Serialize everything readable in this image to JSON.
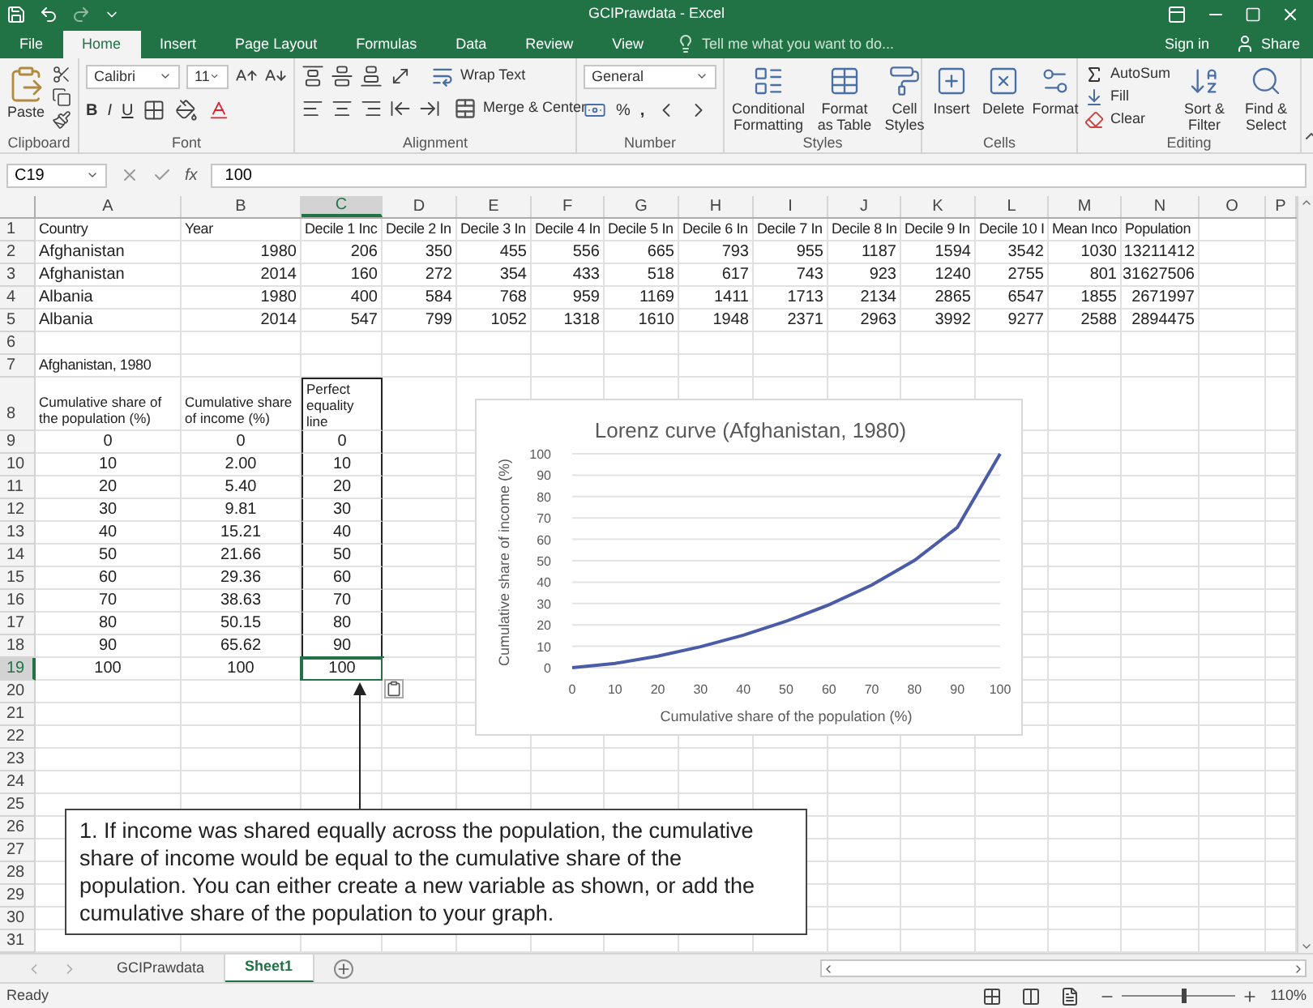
{
  "window": {
    "title": "GCIPrawdata - Excel"
  },
  "menu_tabs": [
    {
      "label": "File",
      "selected": false
    },
    {
      "label": "Home",
      "selected": true
    },
    {
      "label": "Insert",
      "selected": false
    },
    {
      "label": "Page Layout",
      "selected": false
    },
    {
      "label": "Formulas",
      "selected": false
    },
    {
      "label": "Data",
      "selected": false
    },
    {
      "label": "Review",
      "selected": false
    },
    {
      "label": "View",
      "selected": false
    }
  ],
  "tell_me": {
    "placeholder": "Tell me what you want to do..."
  },
  "sign_in": "Sign in",
  "share": "Share",
  "ribbon": {
    "clipboard": {
      "paste": "Paste",
      "label": "Clipboard"
    },
    "font": {
      "name": "Calibri",
      "size": "11",
      "bold": "B",
      "italic": "I",
      "underline": "U",
      "label": "Font"
    },
    "alignment": {
      "wrap": "Wrap Text",
      "merge": "Merge & Center",
      "label": "Alignment"
    },
    "number": {
      "format": "General",
      "percent": "%",
      "comma": ",",
      "label": "Number"
    },
    "styles": {
      "buttons": [
        "Conditional Formatting",
        "Format as Table",
        "Cell Styles"
      ],
      "label": "Styles"
    },
    "cells": {
      "buttons": [
        "Insert",
        "Delete",
        "Format"
      ],
      "label": "Cells"
    },
    "editing": {
      "autosum": "AutoSum",
      "fill": "Fill",
      "clear": "Clear",
      "buttons": [
        "Sort & Filter",
        "Find & Select"
      ],
      "label": "Editing"
    }
  },
  "formula_bar": {
    "name_box": "C19",
    "fx": "fx",
    "value": "100"
  },
  "columns": [
    {
      "label": "A",
      "selected": false
    },
    {
      "label": "B",
      "selected": false
    },
    {
      "label": "C",
      "selected": true
    },
    {
      "label": "D",
      "selected": false
    },
    {
      "label": "E",
      "selected": false
    },
    {
      "label": "F",
      "selected": false
    },
    {
      "label": "G",
      "selected": false
    },
    {
      "label": "H",
      "selected": false
    },
    {
      "label": "I",
      "selected": false
    },
    {
      "label": "J",
      "selected": false
    },
    {
      "label": "K",
      "selected": false
    },
    {
      "label": "L",
      "selected": false
    },
    {
      "label": "M",
      "selected": false
    },
    {
      "label": "N",
      "selected": false
    },
    {
      "label": "O",
      "selected": false
    },
    {
      "label": "P",
      "selected": false
    }
  ],
  "rows": [
    {
      "number": "1",
      "kind": "header",
      "selected": false,
      "cells": [
        "Country",
        "Year",
        "Decile 1 Inc",
        "Decile 2 In",
        "Decile 3 In",
        "Decile 4 In",
        "Decile 5 In",
        "Decile 6 In",
        "Decile 7 In",
        "Decile 8 In",
        "Decile 9 In",
        "Decile 10 I",
        "Mean Inco",
        "Population"
      ]
    },
    {
      "number": "2",
      "kind": "data",
      "selected": false,
      "cells": [
        "Afghanistan",
        "1980",
        "206",
        "350",
        "455",
        "556",
        "665",
        "793",
        "955",
        "1187",
        "1594",
        "3542",
        "1030",
        "13211412"
      ]
    },
    {
      "number": "3",
      "kind": "data",
      "selected": false,
      "cells": [
        "Afghanistan",
        "2014",
        "160",
        "272",
        "354",
        "433",
        "518",
        "617",
        "743",
        "923",
        "1240",
        "2755",
        "801",
        "31627506"
      ]
    },
    {
      "number": "4",
      "kind": "data",
      "selected": false,
      "cells": [
        "Albania",
        "1980",
        "400",
        "584",
        "768",
        "959",
        "1169",
        "1411",
        "1713",
        "2134",
        "2865",
        "6547",
        "1855",
        "2671997"
      ]
    },
    {
      "number": "5",
      "kind": "data",
      "selected": false,
      "cells": [
        "Albania",
        "2014",
        "547",
        "799",
        "1052",
        "1318",
        "1610",
        "1948",
        "2371",
        "2963",
        "3992",
        "9277",
        "2588",
        "2894475"
      ]
    },
    {
      "number": "6",
      "kind": "data",
      "selected": false,
      "cells": []
    },
    {
      "number": "7",
      "kind": "header",
      "selected": false,
      "cells": [
        "Afghanistan, 1980"
      ]
    },
    {
      "number": "8",
      "kind": "wrapped",
      "selected": false,
      "boxed": true,
      "cells": [
        "Cumulative share of the population (%)",
        "Cumulative share of income (%)",
        "Perfect equality line"
      ]
    },
    {
      "number": "9",
      "kind": "centered",
      "selected": false,
      "boxed": true,
      "cells": [
        "0",
        "0",
        "0"
      ]
    },
    {
      "number": "10",
      "kind": "centered",
      "selected": false,
      "boxed": true,
      "cells": [
        "10",
        "2.00",
        "10"
      ]
    },
    {
      "number": "11",
      "kind": "centered",
      "selected": false,
      "boxed": true,
      "cells": [
        "20",
        "5.40",
        "20"
      ]
    },
    {
      "number": "12",
      "kind": "centered",
      "selected": false,
      "boxed": true,
      "cells": [
        "30",
        "9.81",
        "30"
      ]
    },
    {
      "number": "13",
      "kind": "centered",
      "selected": false,
      "boxed": true,
      "cells": [
        "40",
        "15.21",
        "40"
      ]
    },
    {
      "number": "14",
      "kind": "centered",
      "selected": false,
      "boxed": true,
      "cells": [
        "50",
        "21.66",
        "50"
      ]
    },
    {
      "number": "15",
      "kind": "centered",
      "selected": false,
      "boxed": true,
      "cells": [
        "60",
        "29.36",
        "60"
      ]
    },
    {
      "number": "16",
      "kind": "centered",
      "selected": false,
      "boxed": true,
      "cells": [
        "70",
        "38.63",
        "70"
      ]
    },
    {
      "number": "17",
      "kind": "centered",
      "selected": false,
      "boxed": true,
      "cells": [
        "80",
        "50.15",
        "80"
      ]
    },
    {
      "number": "18",
      "kind": "centered",
      "selected": false,
      "boxed": true,
      "cells": [
        "90",
        "65.62",
        "90"
      ]
    },
    {
      "number": "19",
      "kind": "centered",
      "selected": true,
      "boxed": true,
      "cells": [
        "100",
        "100",
        "100"
      ]
    },
    {
      "number": "20",
      "kind": "data",
      "selected": false,
      "cells": []
    },
    {
      "number": "21",
      "kind": "data",
      "selected": false,
      "cells": []
    },
    {
      "number": "22",
      "kind": "data",
      "selected": false,
      "cells": []
    },
    {
      "number": "23",
      "kind": "data",
      "selected": false,
      "cells": []
    },
    {
      "number": "24",
      "kind": "data",
      "selected": false,
      "cells": []
    },
    {
      "number": "25",
      "kind": "data",
      "selected": false,
      "cells": []
    },
    {
      "number": "26",
      "kind": "data",
      "selected": false,
      "cells": []
    },
    {
      "number": "27",
      "kind": "data",
      "selected": false,
      "cells": []
    },
    {
      "number": "28",
      "kind": "data",
      "selected": false,
      "cells": []
    },
    {
      "number": "29",
      "kind": "data",
      "selected": false,
      "cells": []
    },
    {
      "number": "30",
      "kind": "data",
      "selected": false,
      "cells": []
    },
    {
      "number": "31",
      "kind": "data",
      "selected": false,
      "cells": []
    }
  ],
  "chart": {
    "chart_data": {
      "type": "line",
      "title": "Lorenz curve (Afghanistan, 1980)",
      "xlabel": "Cumulative share of the population (%)",
      "ylabel": "Cumulative share of income (%)",
      "x": [
        0,
        10,
        20,
        30,
        40,
        50,
        60,
        70,
        80,
        90,
        100
      ],
      "series": [
        {
          "color": "#4a5ca8",
          "values": [
            0,
            2,
            5.4,
            9.8,
            15.2,
            21.7,
            29.4,
            38.6,
            50.2,
            65.6,
            100
          ]
        }
      ],
      "xticks": [
        0,
        10,
        20,
        30,
        40,
        50,
        60,
        70,
        80,
        90,
        100
      ],
      "xlim": [
        0,
        100
      ],
      "grid": true,
      "yticks": [
        0,
        10,
        20,
        30,
        40,
        50,
        60,
        70,
        80,
        90,
        100
      ],
      "ylim": [
        0,
        100
      ]
    }
  },
  "callout": "1. If income was shared equally across the population, the cumulative share of income would be equal to the cumulative share of the population. You can either create a new variable as shown, or add the cumulative share of the population to your graph.",
  "sheet_tabs": [
    {
      "label": "GCIPrawdata",
      "selected": false
    },
    {
      "label": "Sheet1",
      "selected": true
    }
  ],
  "status_bar": {
    "status": "Ready",
    "zoom": {
      "level": 0.55,
      "reading": "110%"
    }
  }
}
